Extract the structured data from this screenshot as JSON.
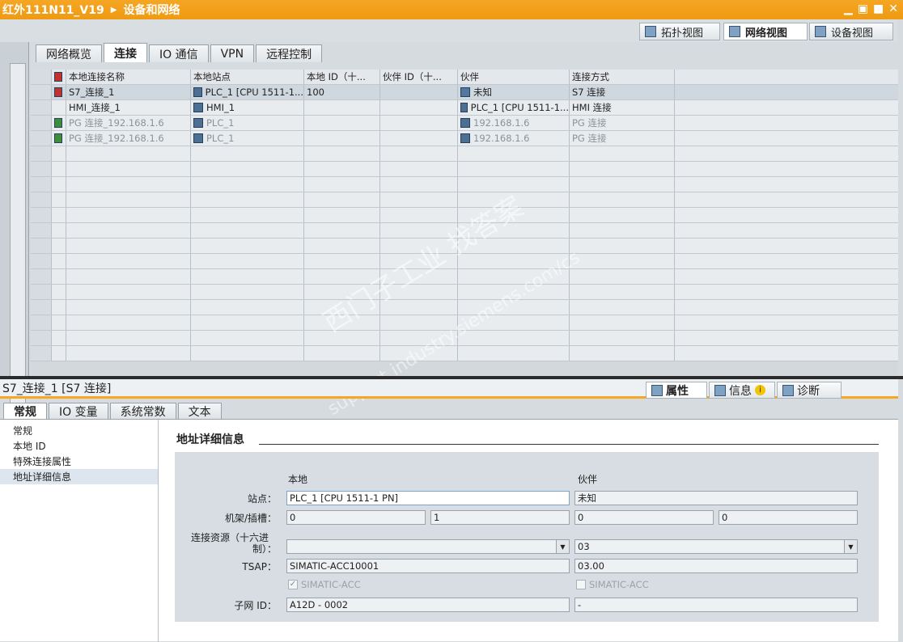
{
  "window": {
    "project": "红外111N11_V19",
    "breadcrumb": "设备和网络",
    "min": "▁",
    "restore": "▣",
    "max": "■",
    "close": "✕"
  },
  "views": [
    {
      "label": "拓扑视图",
      "icon": "topology-icon"
    },
    {
      "label": "网络视图",
      "icon": "network-icon"
    },
    {
      "label": "设备视图",
      "icon": "device-icon"
    }
  ],
  "tabs": [
    "网络概览",
    "连接",
    "IO 通信",
    "VPN",
    "远程控制"
  ],
  "grid": {
    "headers": [
      "",
      "本地连接名称",
      "本地站点",
      "本地 ID（十...",
      "伙伴 ID（十...",
      "伙伴",
      "连接方式"
    ],
    "rows": [
      {
        "icon": "s7-connection-icon",
        "name": "S7_连接_1",
        "station": "PLC_1 [CPU 1511-1...",
        "local_id": "100",
        "partner_id": "",
        "partner": "未知",
        "type": "S7 连接"
      },
      {
        "icon": "",
        "name": "HMI_连接_1",
        "station": "HMI_1",
        "local_id": "",
        "partner_id": "",
        "partner": "PLC_1 [CPU 1511-1...",
        "type": "HMI 连接"
      },
      {
        "icon": "pg-connection-icon",
        "name": "PG 连接_192.168.1.6",
        "station": "PLC_1",
        "local_id": "",
        "partner_id": "",
        "partner": "192.168.1.6",
        "type": "PG 连接"
      },
      {
        "icon": "pg-connection-icon",
        "name": "PG 连接_192.168.1.6",
        "station": "PLC_1",
        "local_id": "",
        "partner_id": "",
        "partner": "192.168.1.6",
        "type": "PG 连接"
      }
    ]
  },
  "watermark": {
    "line1": "西门子工业  找答案",
    "line2": "support.industry.siemens.com/cs"
  },
  "properties": {
    "title": "S7_连接_1 [S7 连接]",
    "tabs": [
      "属性",
      "信息",
      "诊断"
    ],
    "info_badge": "i",
    "subtabs": [
      "常规",
      "IO 变量",
      "系统常数",
      "文本"
    ],
    "nav": [
      "常规",
      "本地 ID",
      "特殊连接属性",
      "地址详细信息"
    ],
    "section_title": "地址详细信息",
    "col_local": "本地",
    "col_partner": "伙伴",
    "labels": {
      "station": "站点：",
      "rack": "机架/插槽：",
      "resource1": "连接资源（十六进",
      "resource2": "制）：",
      "tsap": "TSAP：",
      "subnet": "子网 ID："
    },
    "local": {
      "station": "PLC_1 [CPU 1511-1 PN]",
      "rack": "0",
      "slot": "1",
      "resource": "",
      "tsap": "SIMATIC-ACC10001",
      "checkbox": "SIMATIC-ACC",
      "checked": true,
      "subnet": "A12D - 0002"
    },
    "partner": {
      "station": "未知",
      "rack": "0",
      "slot": "0",
      "resource": "03",
      "tsap": "03.00",
      "checkbox": "SIMATIC-ACC",
      "checked": false,
      "subnet": "-"
    }
  }
}
